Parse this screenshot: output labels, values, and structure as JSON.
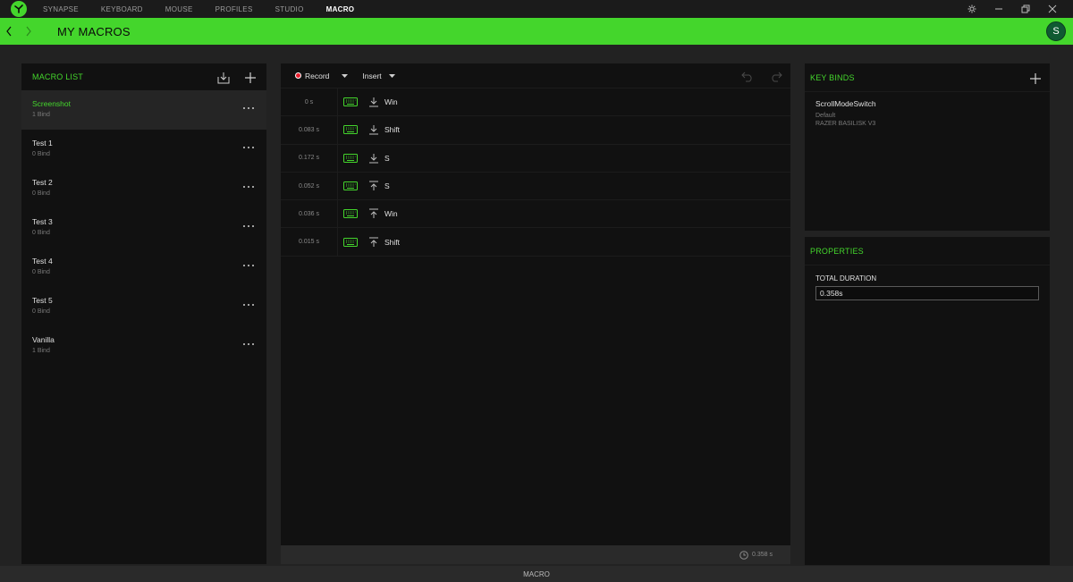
{
  "nav": {
    "tabs": [
      {
        "label": "SYNAPSE"
      },
      {
        "label": "KEYBOARD"
      },
      {
        "label": "MOUSE"
      },
      {
        "label": "PROFILES"
      },
      {
        "label": "STUDIO"
      },
      {
        "label": "MACRO",
        "active": true
      }
    ]
  },
  "header": {
    "title": "MY MACROS",
    "avatar_initial": "S"
  },
  "macro_list": {
    "title": "MACRO LIST",
    "items": [
      {
        "name": "Screenshot",
        "binds": "1 Bind",
        "selected": true
      },
      {
        "name": "Test 1",
        "binds": "0 Bind"
      },
      {
        "name": "Test 2",
        "binds": "0 Bind"
      },
      {
        "name": "Test 3",
        "binds": "0 Bind"
      },
      {
        "name": "Test 4",
        "binds": "0 Bind"
      },
      {
        "name": "Test 5",
        "binds": "0 Bind"
      },
      {
        "name": "Vanilla",
        "binds": "1 Bind"
      }
    ]
  },
  "editor": {
    "record_label": "Record",
    "insert_label": "Insert",
    "rows": [
      {
        "time": "0 s",
        "direction": "down",
        "key": "Win"
      },
      {
        "time": "0.083 s",
        "direction": "down",
        "key": "Shift"
      },
      {
        "time": "0.172 s",
        "direction": "down",
        "key": "S"
      },
      {
        "time": "0.052 s",
        "direction": "up",
        "key": "S"
      },
      {
        "time": "0.036 s",
        "direction": "up",
        "key": "Win"
      },
      {
        "time": "0.015 s",
        "direction": "up",
        "key": "Shift"
      }
    ],
    "footer_duration": "0.358 s"
  },
  "key_binds": {
    "title": "KEY BINDS",
    "name": "ScrollModeSwitch",
    "profile": "Default",
    "device": "RAZER BASILISK V3"
  },
  "properties": {
    "title": "PROPERTIES",
    "total_duration_label": "TOTAL DURATION",
    "total_duration_value": "0.358s"
  },
  "bottom_bar": {
    "label": "MACRO"
  },
  "colors": {
    "accent": "#44d62c",
    "panel": "#111111",
    "background": "#222222"
  }
}
